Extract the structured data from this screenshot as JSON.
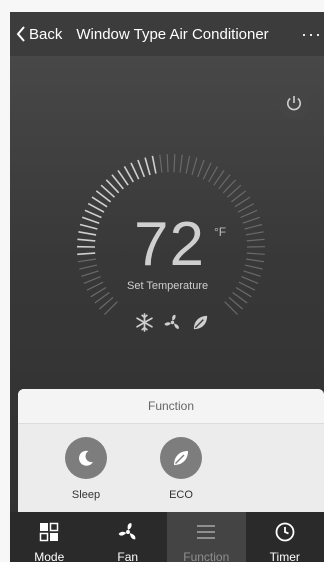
{
  "header": {
    "back_label": "Back",
    "title": "Window Type Air Conditioner",
    "more_label": "···"
  },
  "thermostat": {
    "temperature": "72",
    "unit": "°F",
    "caption": "Set Temperature"
  },
  "function_sheet": {
    "title": "Function",
    "items": [
      {
        "label": "Sleep",
        "icon": "moon-icon"
      },
      {
        "label": "ECO",
        "icon": "leaf-icon"
      }
    ]
  },
  "tabbar": {
    "tabs": [
      {
        "label": "Mode",
        "icon": "mode-icon"
      },
      {
        "label": "Fan",
        "icon": "fan-icon"
      },
      {
        "label": "Function",
        "icon": "menu-icon",
        "active": true
      },
      {
        "label": "Timer",
        "icon": "clock-icon"
      }
    ]
  },
  "colors": {
    "background": "#383838",
    "sheet": "#ececec",
    "tabbar": "#2a2a2a",
    "active_tab": "#444444"
  }
}
